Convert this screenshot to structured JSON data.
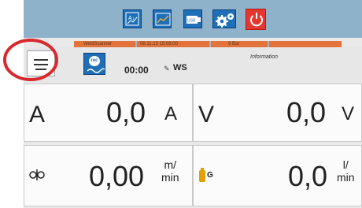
{
  "toolbar": {
    "icons": [
      "graph-scale-icon",
      "chart-icon",
      "usb-icon",
      "settings-gears-icon",
      "power-icon"
    ],
    "graph_icon_text": "A↓",
    "usb_label": "USB"
  },
  "status_strip": {
    "segments": [
      "WeldScanner",
      "08.11.15 15:08:00",
      "9 Bar",
      ""
    ]
  },
  "info_row": {
    "rec_label": "rec",
    "time": "00:00",
    "ws": "WS",
    "information_label": "Information"
  },
  "readings": {
    "current": {
      "symbol": "A",
      "value": "0,0",
      "unit": "A"
    },
    "voltage": {
      "symbol": "V",
      "value": "0,0",
      "unit": "V"
    },
    "wire_feed": {
      "value": "0,00",
      "unit_top": "m/",
      "unit_bottom": "min"
    },
    "gas": {
      "label": "G",
      "value": "0,0",
      "unit_top": "l/",
      "unit_bottom": "min"
    }
  },
  "colors": {
    "accent_blue": "#1e6fb7",
    "topbar": "#8fb2cb",
    "strip": "#e3733a",
    "power": "#e53730",
    "annotation": "#d8292c"
  }
}
